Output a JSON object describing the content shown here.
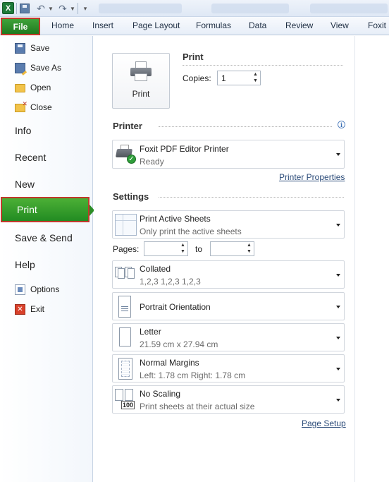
{
  "window": {
    "app_icon": "X",
    "app_icon_name": "excel-icon"
  },
  "ribbon": {
    "file_tab": "File",
    "tabs": [
      "Home",
      "Insert",
      "Page Layout",
      "Formulas",
      "Data",
      "Review",
      "View",
      "Foxit"
    ]
  },
  "backstage": {
    "commands": [
      {
        "label": "Save",
        "icon": "save-icon"
      },
      {
        "label": "Save As",
        "icon": "save-as-icon"
      },
      {
        "label": "Open",
        "icon": "folder-open-icon"
      },
      {
        "label": "Close",
        "icon": "close-file-icon"
      }
    ],
    "sections": [
      "Info",
      "Recent",
      "New",
      "Print",
      "Save & Send",
      "Help"
    ],
    "active_section": "Print",
    "bottom": [
      {
        "label": "Options",
        "icon": "options-icon"
      },
      {
        "label": "Exit",
        "icon": "exit-icon"
      }
    ]
  },
  "print": {
    "heading": "Print",
    "button_label": "Print",
    "copies_label": "Copies:",
    "copies_value": "1",
    "printer_heading": "Printer",
    "printer_name": "Foxit PDF Editor Printer",
    "printer_status": "Ready",
    "printer_properties": "Printer Properties",
    "settings_heading": "Settings",
    "what_to_print": {
      "title": "Print Active Sheets",
      "subtitle": "Only print the active sheets"
    },
    "pages_label": "Pages:",
    "pages_from": "",
    "pages_to_label": "to",
    "pages_to": "",
    "collation": {
      "title": "Collated",
      "subtitle": "1,2,3    1,2,3    1,2,3"
    },
    "orientation": {
      "title": "Portrait Orientation"
    },
    "paper": {
      "title": "Letter",
      "subtitle": "21.59 cm x 27.94 cm"
    },
    "margins": {
      "title": "Normal Margins",
      "subtitle": "Left:  1.78 cm    Right:  1.78 cm"
    },
    "scaling": {
      "title": "No Scaling",
      "subtitle": "Print sheets at their actual size",
      "icon_text": "100"
    },
    "page_setup": "Page Setup"
  },
  "colors": {
    "file_green": "#228b22",
    "highlight_red": "#c0392b",
    "link_blue": "#2a4a78"
  }
}
